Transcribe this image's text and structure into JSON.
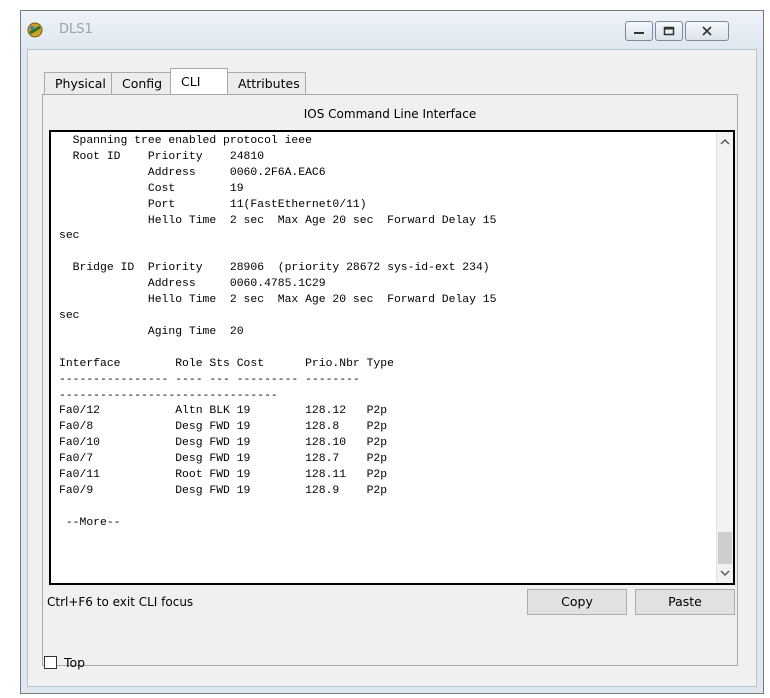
{
  "window": {
    "title": "DLS1"
  },
  "tabs": [
    {
      "label": "Physical"
    },
    {
      "label": "Config"
    },
    {
      "label": "CLI"
    },
    {
      "label": "Attributes"
    }
  ],
  "cli": {
    "header": "IOS Command Line Interface",
    "lines": [
      "  Spanning tree enabled protocol ieee",
      "  Root ID    Priority    24810",
      "             Address     0060.2F6A.EAC6",
      "             Cost        19",
      "             Port        11(FastEthernet0/11)",
      "             Hello Time  2 sec  Max Age 20 sec  Forward Delay 15",
      "sec",
      "",
      "  Bridge ID  Priority    28906  (priority 28672 sys-id-ext 234)",
      "             Address     0060.4785.1C29",
      "             Hello Time  2 sec  Max Age 20 sec  Forward Delay 15",
      "sec",
      "             Aging Time  20",
      "",
      "Interface        Role Sts Cost      Prio.Nbr Type",
      "---------------- ---- --- --------- --------",
      "--------------------------------",
      "Fa0/12           Altn BLK 19        128.12   P2p",
      "Fa0/8            Desg FWD 19        128.8    P2p",
      "Fa0/10           Desg FWD 19        128.10   P2p",
      "Fa0/7            Desg FWD 19        128.7    P2p",
      "Fa0/11           Root FWD 19        128.11   P2p",
      "Fa0/9            Desg FWD 19        128.9    P2p",
      "",
      " --More--"
    ],
    "hint": "Ctrl+F6 to exit CLI focus",
    "copy_label": "Copy",
    "paste_label": "Paste"
  },
  "footer": {
    "top_label": "Top"
  }
}
